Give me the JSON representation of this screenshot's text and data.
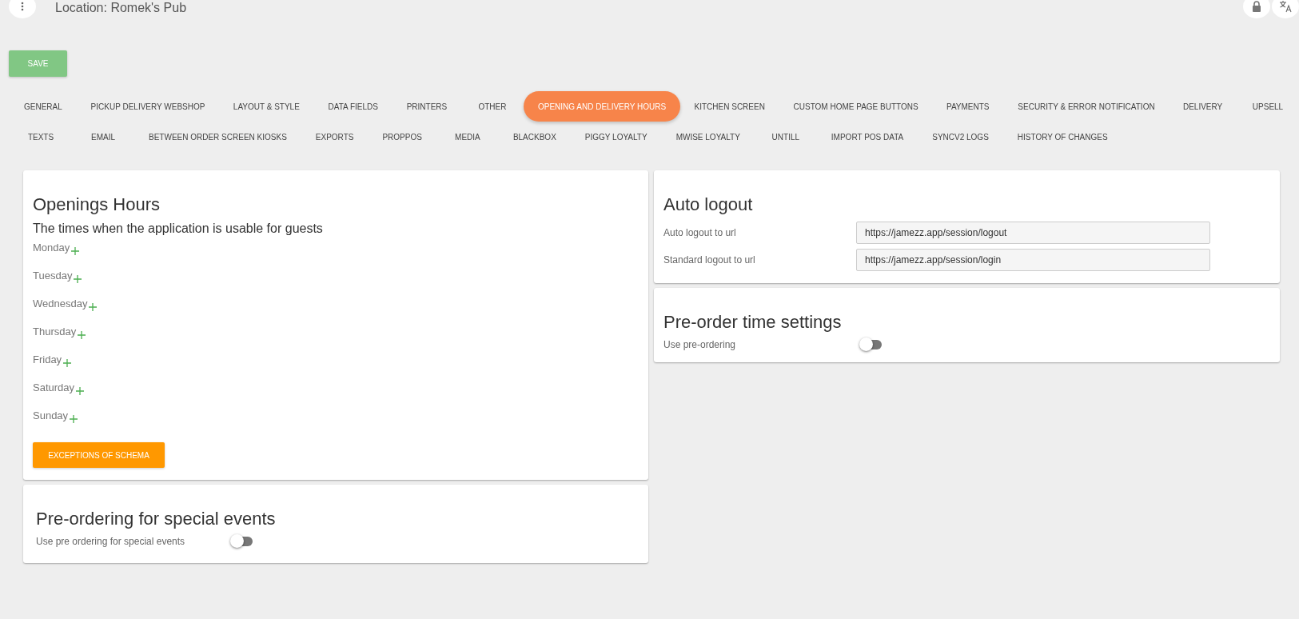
{
  "header": {
    "title": "Location: Romek's Pub"
  },
  "save_button": "SAVE",
  "tab_rows": [
    [
      {
        "label": "GENERAL",
        "selected": false
      },
      {
        "label": "PICKUP DELIVERY WEBSHOP",
        "selected": false
      },
      {
        "label": "LAYOUT & STYLE",
        "selected": false
      },
      {
        "label": "DATA FIELDS",
        "selected": false
      },
      {
        "label": "PRINTERS",
        "selected": false
      },
      {
        "label": "OTHER",
        "selected": false
      },
      {
        "label": "OPENING AND DELIVERY HOURS",
        "selected": true
      },
      {
        "label": "KITCHEN SCREEN",
        "selected": false
      },
      {
        "label": "CUSTOM HOME PAGE BUTTONS",
        "selected": false
      },
      {
        "label": "PAYMENTS",
        "selected": false
      },
      {
        "label": "SECURITY & ERROR NOTIFICATION",
        "selected": false
      },
      {
        "label": "DELIVERY",
        "selected": false
      },
      {
        "label": "UPSELL",
        "selected": false
      }
    ],
    [
      {
        "label": "TEXTS",
        "selected": false
      },
      {
        "label": "EMAIL",
        "selected": false
      },
      {
        "label": "BETWEEN ORDER SCREEN KIOSKS",
        "selected": false
      },
      {
        "label": "EXPORTS",
        "selected": false
      },
      {
        "label": "PROPPOS",
        "selected": false
      },
      {
        "label": "MEDIA",
        "selected": false
      },
      {
        "label": "BLACKBOX",
        "selected": false
      },
      {
        "label": "PIGGY LOYALTY",
        "selected": false
      },
      {
        "label": "MWISE LOYALTY",
        "selected": false
      },
      {
        "label": "UNTILL",
        "selected": false
      },
      {
        "label": "IMPORT POS DATA",
        "selected": false
      },
      {
        "label": "SYNCV2 LOGS",
        "selected": false
      },
      {
        "label": "HISTORY OF CHANGES",
        "selected": false
      }
    ]
  ],
  "opening_hours": {
    "title": "Openings Hours",
    "subtitle": "The times when the application is usable for guests",
    "days": [
      "Monday",
      "Tuesday",
      "Wednesday",
      "Thursday",
      "Friday",
      "Saturday",
      "Sunday"
    ],
    "button": "EXCEPTIONS OF SCHEMA"
  },
  "special_events": {
    "title": "Pre-ordering for special events",
    "setting": {
      "label": "Use pre ordering for special events",
      "on": false
    }
  },
  "auto_logout": {
    "title": "Auto logout",
    "fields": [
      {
        "label": "Auto logout to url",
        "value": "https://jamezz.app/session/logout"
      },
      {
        "label": "Standard logout to url",
        "value": "https://jamezz.app/session/login"
      }
    ]
  },
  "pre_order": {
    "title": "Pre-order time settings",
    "setting": {
      "label": "Use pre-ordering",
      "on": false
    }
  }
}
